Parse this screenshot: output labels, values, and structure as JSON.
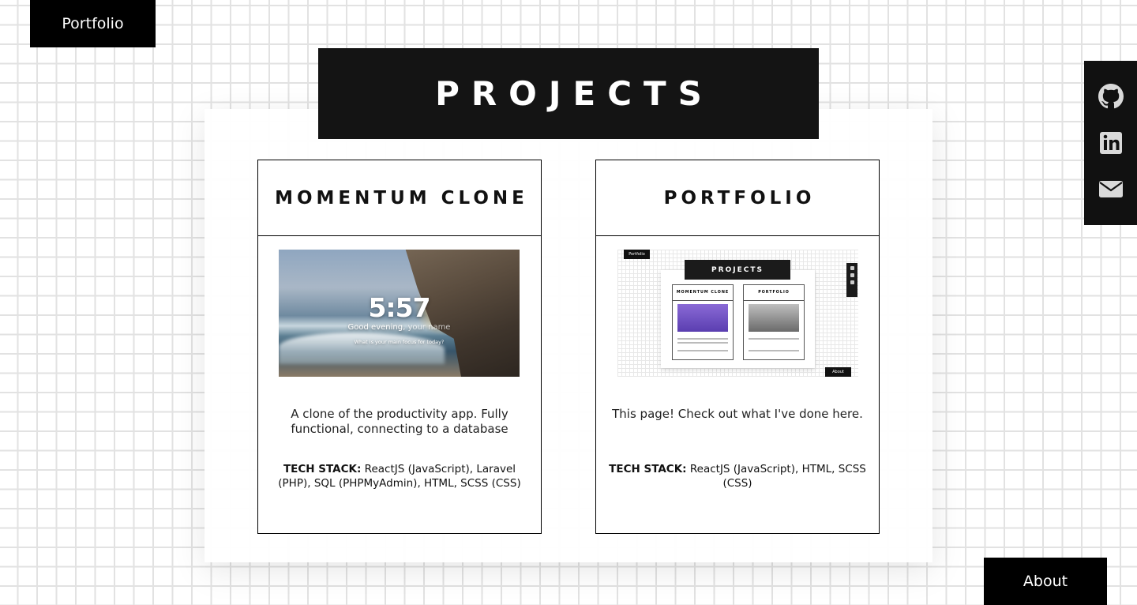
{
  "nav": {
    "portfolio_label": "Portfolio",
    "about_label": "About"
  },
  "page": {
    "title": "PROJECTS"
  },
  "projects": [
    {
      "title": "MOMENTUM CLONE",
      "description": "A clone of the productivity app. Fully functional, connecting to a database",
      "stack_label": "TECH STACK:",
      "stack": "ReactJS (JavaScript), Laravel (PHP), SQL (PHPMyAdmin), HTML, SCSS (CSS)",
      "screenshot": {
        "time": "5:57",
        "greeting": "Good evening,",
        "name_placeholder": "your name",
        "focus_prompt": "What is your main focus for today?"
      }
    },
    {
      "title": "PORTFOLIO",
      "description": "This page! Check out what I've done here.",
      "stack_label": "TECH STACK:",
      "stack": "ReactJS (JavaScript), HTML, SCSS (CSS)",
      "screenshot": {
        "nav_label": "Portfolio",
        "title": "PROJECTS",
        "card1_title": "MOMENTUM CLONE",
        "card2_title": "PORTFOLIO",
        "about_label": "About"
      }
    }
  ],
  "social": [
    {
      "icon": "github-icon"
    },
    {
      "icon": "linkedin-icon"
    },
    {
      "icon": "envelope-icon"
    }
  ],
  "colors": {
    "dark": "#111111",
    "background": "#ffffff",
    "grid_line": "#e2e2e2"
  }
}
